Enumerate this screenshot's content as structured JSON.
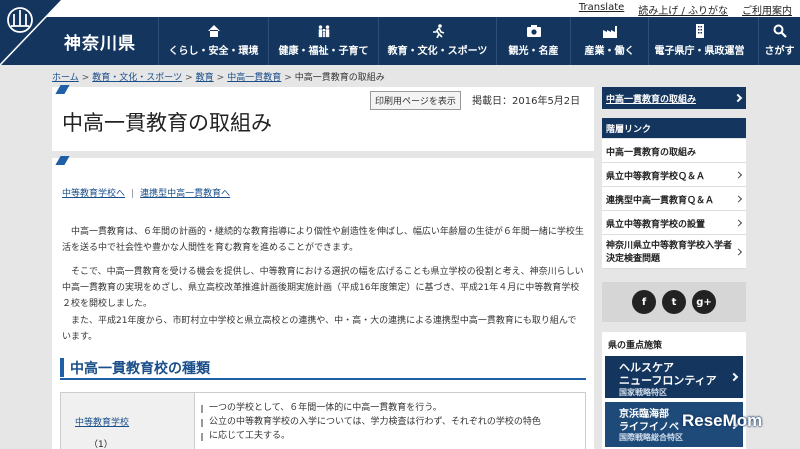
{
  "top_links": [
    "Translate",
    "読み上げ / ふりがな",
    "ご利用案内"
  ],
  "site": {
    "name": "神奈川県",
    "logo_label": "KANAGAWA"
  },
  "nav": [
    {
      "label": "くらし・安全・環境",
      "icon": "home-icon"
    },
    {
      "label": "健康・福祉・子育て",
      "icon": "family-icon"
    },
    {
      "label": "教育・文化・スポーツ",
      "icon": "runner-icon"
    },
    {
      "label": "観光・名産",
      "icon": "camera-icon"
    },
    {
      "label": "産業・働く",
      "icon": "factory-icon"
    },
    {
      "label": "電子県庁・県政運営",
      "icon": "building-icon"
    }
  ],
  "search_label": "さがす",
  "breadcrumb": [
    "ホーム",
    "教育・文化・スポーツ",
    "教育",
    "中高一貫教育",
    "中高一貫教育の取組み"
  ],
  "print_button": "印刷用ページを表示",
  "posted": "掲載日：2016年5月2日",
  "page_title": "中高一貫教育の取組み",
  "sublinks": [
    "中等教育学校へ",
    "連携型中高一貫教育へ"
  ],
  "paragraphs": [
    "中高一貫教育は、６年間の計画的・継続的な教育指導により個性や創造性を伸ばし、幅広い年齢層の生徒が６年間一緒に学校生活を送る中で社会性や豊かな人間性を育む教育を進めることができます。",
    "そこで、中高一貫教育を受ける機会を提供し、中等教育における選択の幅を広げることも県立学校の役割と考え、神奈川らしい中高一貫教育の実現をめざし、県立高校改革推進計画後期実施計画（平成16年度策定）に基づき、平成21年４月に中等教育学校２校を開校しました。",
    "また、平成21年度から、市町村立中学校と県立高校との連携や、中・高・大の連携による連携型中高一貫教育にも取り組んでいます。"
  ],
  "section_heading": "中高一貫教育校の種類",
  "table": {
    "row_prefix": "（1）",
    "row_link": "中等教育学校",
    "bullets": [
      "一つの学校として、６年間一体的に中高一貫教育を行う。",
      "公立の中等教育学校の入学については、学力検査は行わず、それぞれの学校の特色",
      "に応じて工夫する。"
    ]
  },
  "sidebar": {
    "top_link": "中高一貫教育の取組み",
    "heading": "階層リンク",
    "items": [
      "中高一貫教育の取組み",
      "県立中等教育学校Ｑ＆Ａ",
      "連携型中高一貫教育Ｑ＆Ａ",
      "県立中等教育学校の設置",
      "神奈川県立中等教育学校入学者決定検査問題"
    ],
    "social": [
      "f",
      "t",
      "g+"
    ],
    "key_title": "県の重点施策",
    "banner1": {
      "l1": "ヘルスケア",
      "l2": "ニューフロンティア",
      "l3": "国家戦略特区"
    },
    "banner2": {
      "l1": "京浜臨海部",
      "l2": "ライフイノベ",
      "l3": "国際戦略総合特区"
    }
  },
  "watermark": "ReseMom"
}
